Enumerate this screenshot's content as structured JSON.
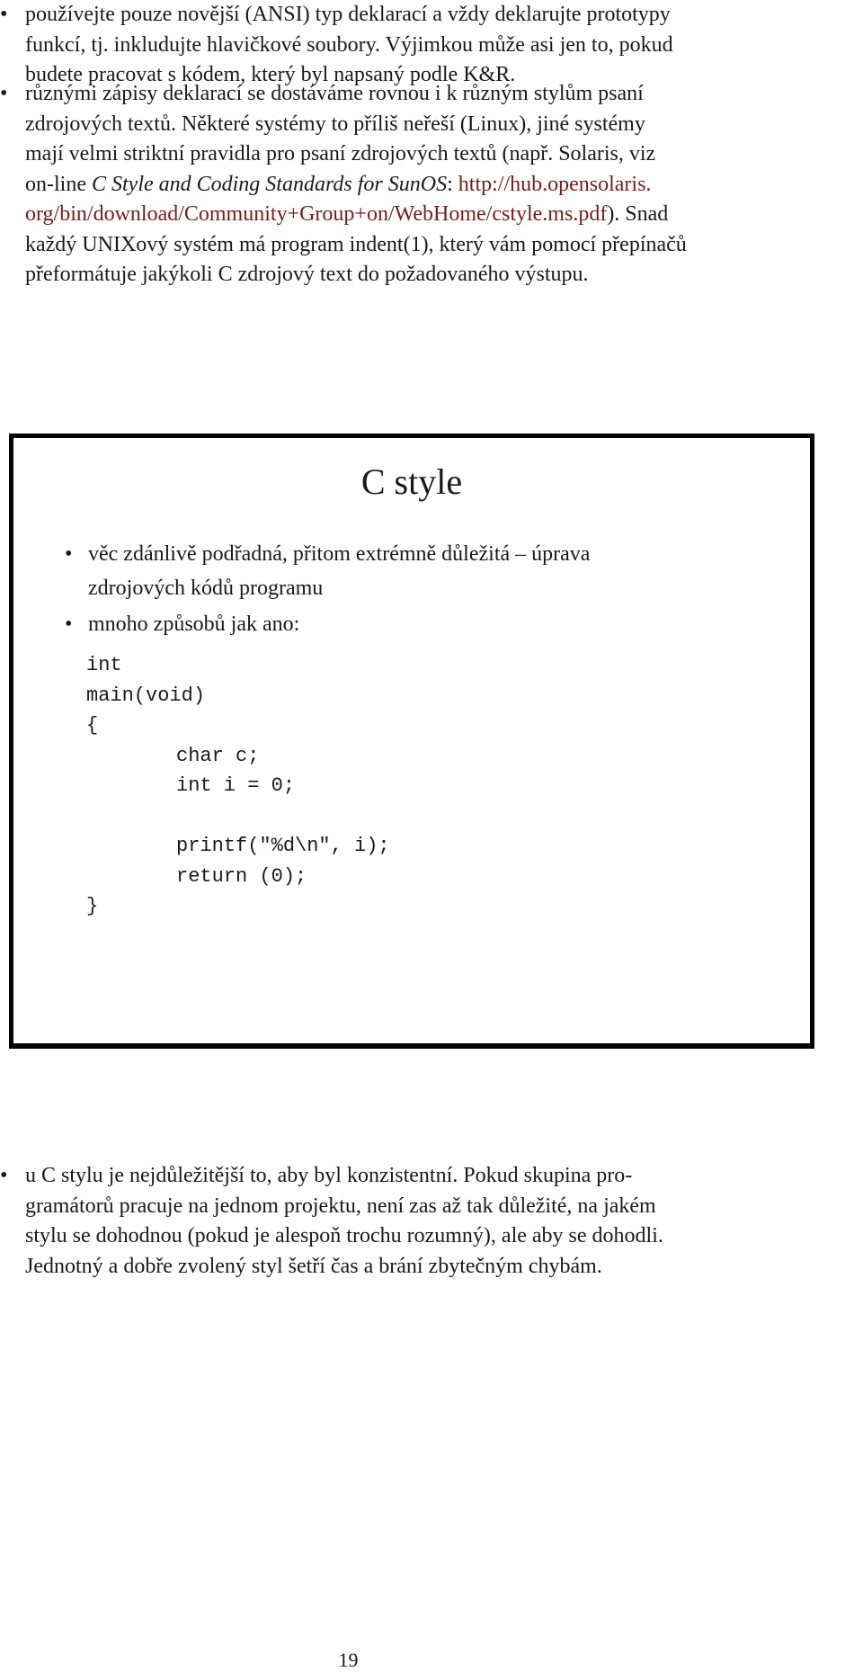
{
  "top_list": [
    {
      "lines": [
        "používejte pouze novější (ANSI) typ deklarací a vždy deklarujte prototypy",
        "funkcí, tj. inkludujte hlavičkové soubory. Výjimkou může asi jen to, pokud",
        "budete pracovat s kódem, který byl napsaný podle K&R."
      ]
    },
    {
      "line1": "různými zápisy deklarací se dostáváme rovnou i k různým stylům psaní",
      "line2": "zdrojových textů. Některé systémy to příliš neřeší (Linux), jiné systémy",
      "line3": "mají velmi striktní pravidla pro psaní zdrojových textů (např. Solaris, viz",
      "line4_prefix": "on-line ",
      "line4_italic": "C Style and Coding Standards for SunOS",
      "line4_colon": ": ",
      "link_part1": "http://hub.opensolaris.",
      "link_part2": "org/bin/download/Community+Group+on/WebHome/cstyle.ms.pdf",
      "line5_suffix": "). Snad",
      "line6": "každý UNIXový systém má program indent(1), který vám pomocí přepínačů",
      "line7": "přeformátuje jakýkoli C zdrojový text do požadovaného výstupu."
    }
  ],
  "slide": {
    "title": "C style",
    "items": [
      {
        "line1": "věc zdánlivě podřadná, přitom extrémně důležitá – úprava",
        "line2": "zdrojových kódů programu"
      },
      {
        "line1": "mnoho způsobů jak ano:"
      }
    ],
    "code": [
      {
        "text": "int",
        "indent": false
      },
      {
        "text": "main(void)",
        "indent": false
      },
      {
        "text": "{",
        "indent": false
      },
      {
        "text": "char c;",
        "indent": true
      },
      {
        "text": "int i = 0;",
        "indent": true
      },
      {
        "text": "",
        "indent": true
      },
      {
        "text": "printf(\"%d\\n\", i);",
        "indent": true
      },
      {
        "text": "return (0);",
        "indent": true
      },
      {
        "text": "}",
        "indent": false
      }
    ]
  },
  "bottom_list": [
    {
      "lines": [
        "u C stylu je nejdůležitější to, aby byl konzistentní. Pokud skupina pro-",
        "gramátorů pracuje na jednom projektu, není zas až tak důležité, na jakém",
        "stylu se dohodnou (pokud je alespoň trochu rozumný), ale aby se dohodli.",
        "Jednotný a dobře zvolený styl šetří čas a brání zbytečným chybám."
      ]
    }
  ],
  "colors": {
    "link": "#7a1a1a",
    "text": "#1a1a1a",
    "border": "#000000"
  },
  "page_number": "19"
}
